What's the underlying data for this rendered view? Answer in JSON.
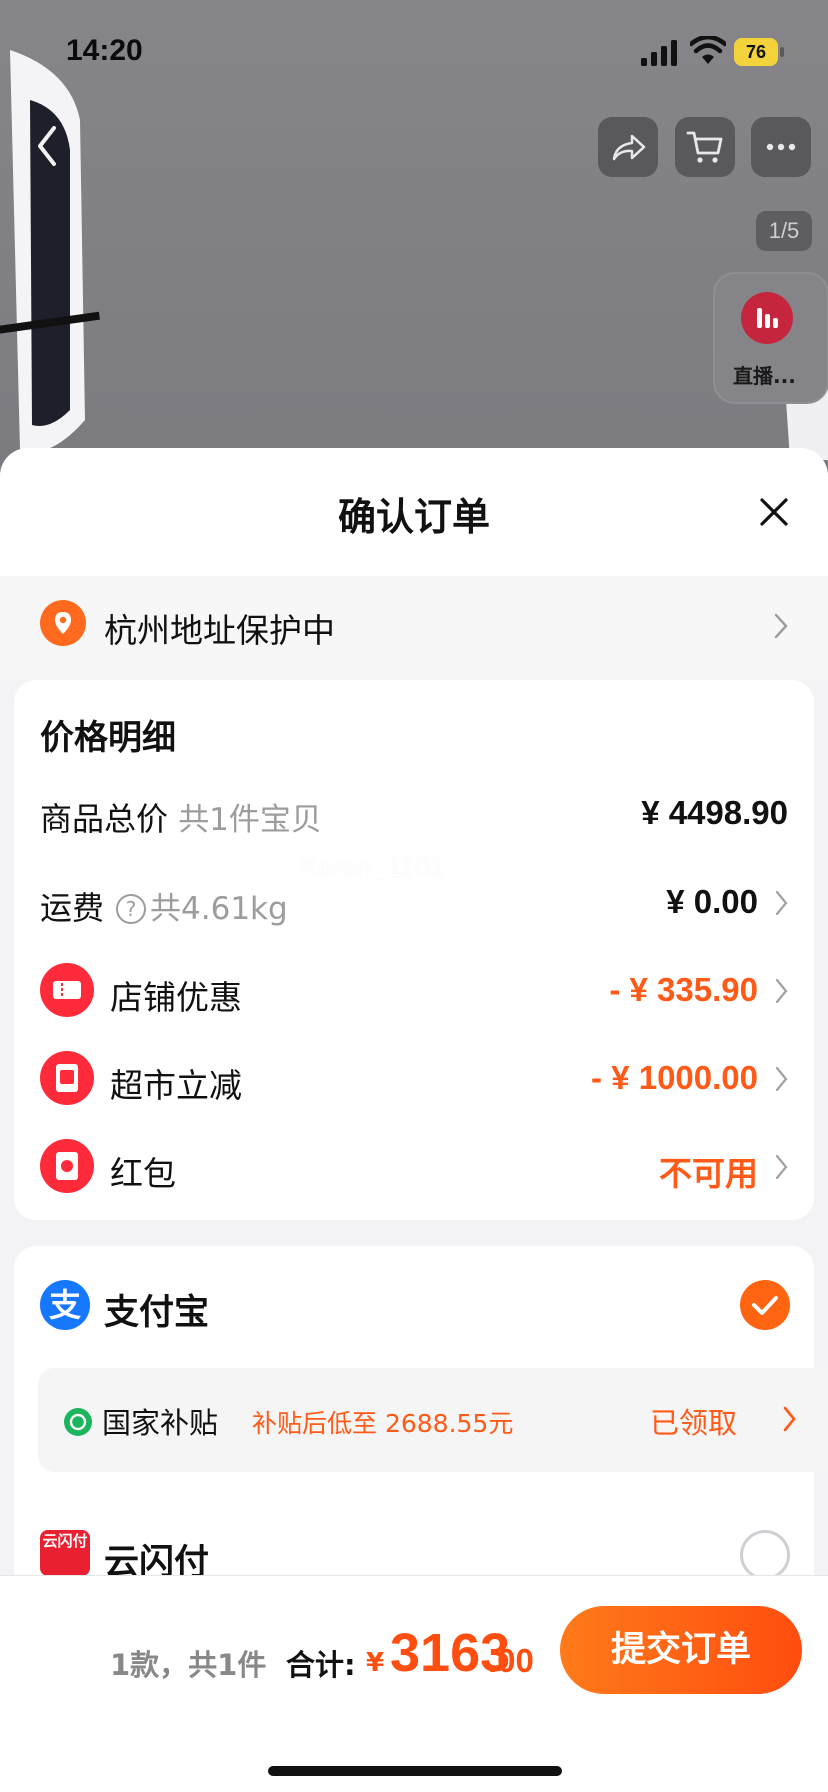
{
  "status_bar": {
    "time": "14:20",
    "battery": "76"
  },
  "gallery": {
    "counter": "1/5",
    "live_label": "直播..."
  },
  "sheet": {
    "title": "确认订单"
  },
  "address": {
    "text": "杭州地址保护中"
  },
  "price_detail": {
    "title": "价格明细",
    "goods_total_label": "商品总价",
    "goods_total_sub": "共1件宝贝",
    "goods_total_value": "¥ 4498.90",
    "shipping_label": "运费",
    "shipping_sub": "共4.61kg",
    "shipping_value": "¥ 0.00",
    "shop_discount_label": "店铺优惠",
    "shop_discount_value": "- ¥ 335.90",
    "market_discount_label": "超市立减",
    "market_discount_value": "- ¥ 1000.00",
    "red_packet_label": "红包",
    "red_packet_value": "不可用"
  },
  "watermark": "Koren_1101",
  "payment": {
    "alipay": "支付宝",
    "subsidy_name": "国家补贴",
    "subsidy_desc": "补贴后低至 2688.55元",
    "subsidy_state": "已领取",
    "unionpay": "云闪付",
    "unionpay_logo": "云闪付"
  },
  "bottom_bar": {
    "count": "1款，共1件",
    "total_label": "合计:",
    "currency": "¥",
    "amount": "3163",
    "cents": ".00",
    "submit": "提交订单"
  },
  "colors": {
    "accent": "#ff5a17",
    "alipay": "#1677ff",
    "coupon_red": "#ff2a3a"
  }
}
